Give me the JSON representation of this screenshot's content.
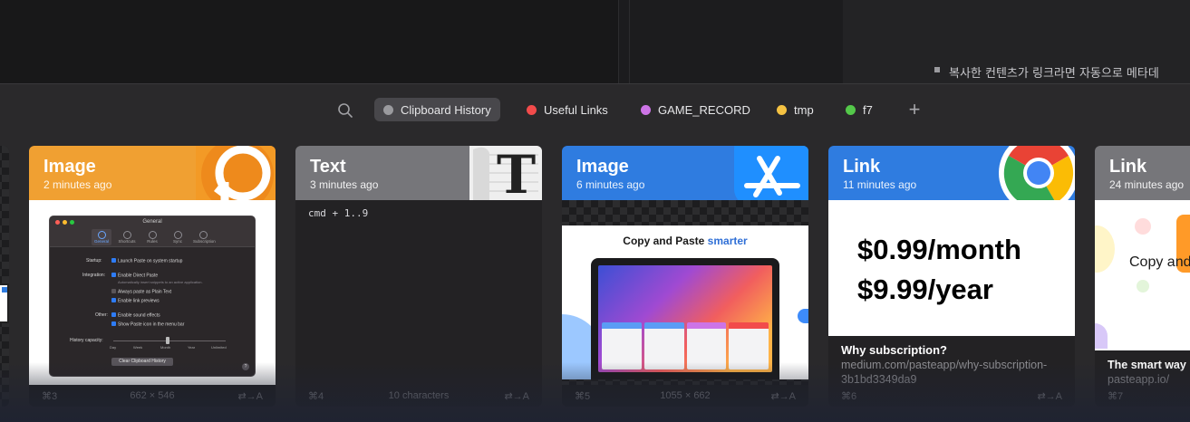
{
  "background_app": {
    "bullet_text": "복사한 컨텐츠가 링크라면 자동으로 메타데"
  },
  "pinboards": [
    {
      "label": "Clipboard History",
      "color": "#9a9a9e",
      "active": true
    },
    {
      "label": "Useful Links",
      "color": "#f24b4b",
      "active": false
    },
    {
      "label": "GAME_RECORD",
      "color": "#cd74e6",
      "active": false
    },
    {
      "label": "tmp",
      "color": "#f5c242",
      "active": false
    },
    {
      "label": "f7",
      "color": "#54c84a",
      "active": false
    }
  ],
  "add_pinboard": "+",
  "cards": [
    {
      "type": "Image",
      "time": "2 minutes ago",
      "header_color": "#f0a032",
      "app_icon": "paste-app-icon",
      "shortcut": "⌘3",
      "meta": "662 × 546",
      "action": "⇄→A",
      "screenshot": {
        "title": "General",
        "tabs": [
          "General",
          "Shortcuts",
          "Rules",
          "Sync",
          "Subscription"
        ],
        "startup_label": "Startup:",
        "startup_option": "Launch Paste on system startup",
        "integration_label": "Integration:",
        "integration_option": "Enable Direct Paste",
        "integration_hint": "Automatically insert snippets to an active application.",
        "plain_text_option": "Always paste as Plain Text",
        "link_previews_option": "Enable link previews",
        "other_label": "Other:",
        "sound_option": "Enable sound effects",
        "menubar_option": "Show Paste icon in the menu bar",
        "history_label": "History capacity:",
        "capacity_marks": [
          "Day",
          "Week",
          "Month",
          "Year",
          "Unlimited"
        ],
        "clear_button": "Clear Clipboard History",
        "help": "?"
      }
    },
    {
      "type": "Text",
      "time": "3 minutes ago",
      "header_color": "#76767a",
      "app_icon": "textedit-icon",
      "content": "cmd + 1..9",
      "shortcut": "⌘4",
      "meta": "10 characters",
      "action": "⇄→A"
    },
    {
      "type": "Image",
      "time": "6 minutes ago",
      "header_color": "#2f7ce0",
      "app_icon": "app-store-icon",
      "image_heading": "Copy and Paste",
      "image_heading_accent": "smarter",
      "shortcut": "⌘5",
      "meta": "1055 × 662",
      "action": "⇄→A"
    },
    {
      "type": "Link",
      "time": "11 minutes ago",
      "header_color": "#2f7ce0",
      "app_icon": "chrome-icon",
      "preview_line1": "$0.99/month",
      "preview_line2": "$9.99/year",
      "title": "Why subscription?",
      "url": "medium.com/pasteapp/why-subscription-3b1bd3349da9",
      "shortcut": "⌘6",
      "action": "⇄→A"
    },
    {
      "type": "Link",
      "time": "24 minutes ago",
      "header_color": "#76767a",
      "preview_text": "Copy and",
      "title": "The smart way",
      "url": "pasteapp.io/",
      "shortcut": "⌘7"
    }
  ]
}
